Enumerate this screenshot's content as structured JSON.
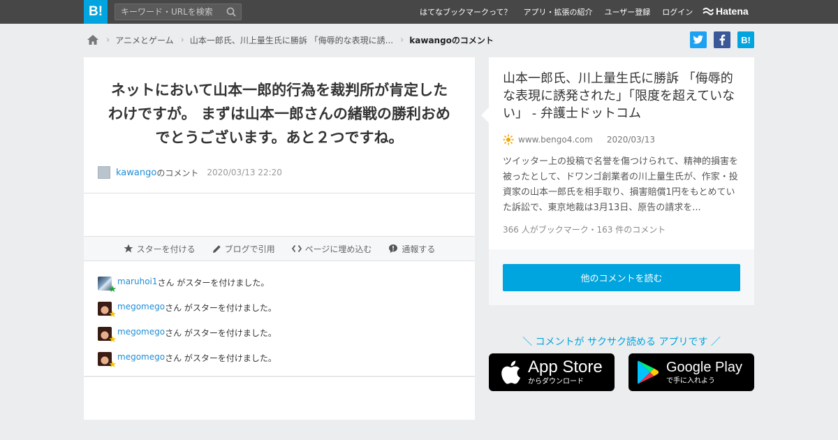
{
  "header": {
    "logo": "B!",
    "search_placeholder": "キーワード・URLを検索",
    "nav": [
      "はてなブックマークって？",
      "アプリ・拡張の紹介",
      "ユーザー登録",
      "ログイン"
    ],
    "brand": "Hatena"
  },
  "breadcrumb": {
    "items": [
      "アニメとゲーム",
      "山本一郎氏、川上量生氏に勝訴 「侮辱的な表現に誘...",
      "kawangoのコメント"
    ]
  },
  "share": {
    "twitter_icon": "twitter-icon",
    "facebook_icon": "facebook-icon",
    "hatebu_label": "B!",
    "colors": {
      "twitter": "#1da1f2",
      "facebook": "#3b5998",
      "hatebu": "#00a4de"
    }
  },
  "comment": {
    "text": "ネットにおいて山本一郎的行為を裁判所が肯定したわけですが。 まずは山本一郎さんの緒戦の勝利おめでとうございます。あと２つですね。",
    "user": "kawango",
    "suffix": "のコメント",
    "date": "2020/03/13 22:20"
  },
  "actions": {
    "star": "スターを付ける",
    "quote": "ブログで引用",
    "embed": "ページに埋め込む",
    "report": "通報する"
  },
  "stars": [
    {
      "user": "maruhoi1",
      "text": "さん がスターを付けました。",
      "star_color": "#1fa335"
    },
    {
      "user": "megomego",
      "text": "さん がスターを付けました。",
      "star_color": "#f5c400"
    },
    {
      "user": "megomego",
      "text": "さん がスターを付けました。",
      "star_color": "#f5c400"
    },
    {
      "user": "megomego",
      "text": "さん がスターを付けました。",
      "star_color": "#f5c400"
    }
  ],
  "entry": {
    "title": "山本一郎氏、川上量生氏に勝訴 「侮辱的な表現に誘発された」「限度を超えていない」 - 弁護士ドットコム",
    "site": "www.bengo4.com",
    "date": "2020/03/13",
    "summary": "ツイッター上の投稿で名誉を傷つけられて、精神的損害を被ったとして、ドワンゴ創業者の川上量生氏が、作家・投資家の山本一郎氏を相手取り、損害賠償1円をもとめていた訴訟で、東京地裁は3月13日、原告の請求を...",
    "counts": "366 人がブックマーク・163 件のコメント",
    "more_button": "他のコメントを読む"
  },
  "promo": {
    "text": "＼ コメントが サクサク読める アプリです ／",
    "app_store": {
      "big": "App Store",
      "small": "からダウンロード"
    },
    "google_play": {
      "big": "Google Play",
      "small": "で手に入れよう"
    }
  },
  "colors": {
    "accent": "#00a4de",
    "topbar": "#474747",
    "link": "#1f8dd6"
  }
}
